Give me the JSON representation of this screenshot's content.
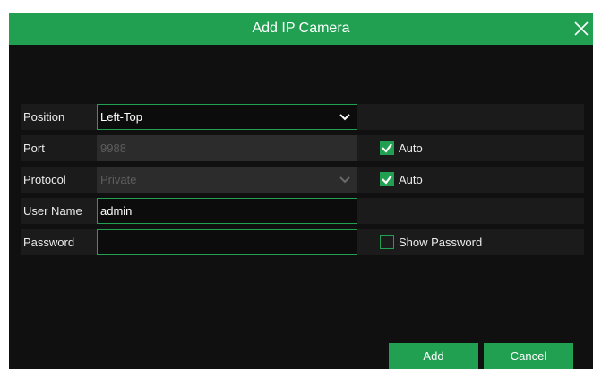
{
  "dialog": {
    "title": "Add IP Camera",
    "close_icon": "close-icon"
  },
  "form": {
    "position": {
      "label": "Position",
      "value": "Left-Top"
    },
    "port": {
      "label": "Port",
      "placeholder": "9988",
      "auto_label": "Auto",
      "auto_checked": true
    },
    "protocol": {
      "label": "Protocol",
      "value": "Private",
      "auto_label": "Auto",
      "auto_checked": true
    },
    "username": {
      "label": "User Name",
      "value": "admin"
    },
    "password": {
      "label": "Password",
      "value": "",
      "show_label": "Show Password",
      "show_checked": false
    }
  },
  "buttons": {
    "add": "Add",
    "cancel": "Cancel"
  },
  "colors": {
    "accent": "#21a052",
    "dialog_bg": "#101010",
    "row_bg": "#1b1b1b",
    "disabled_field": "#2c2c2c"
  }
}
